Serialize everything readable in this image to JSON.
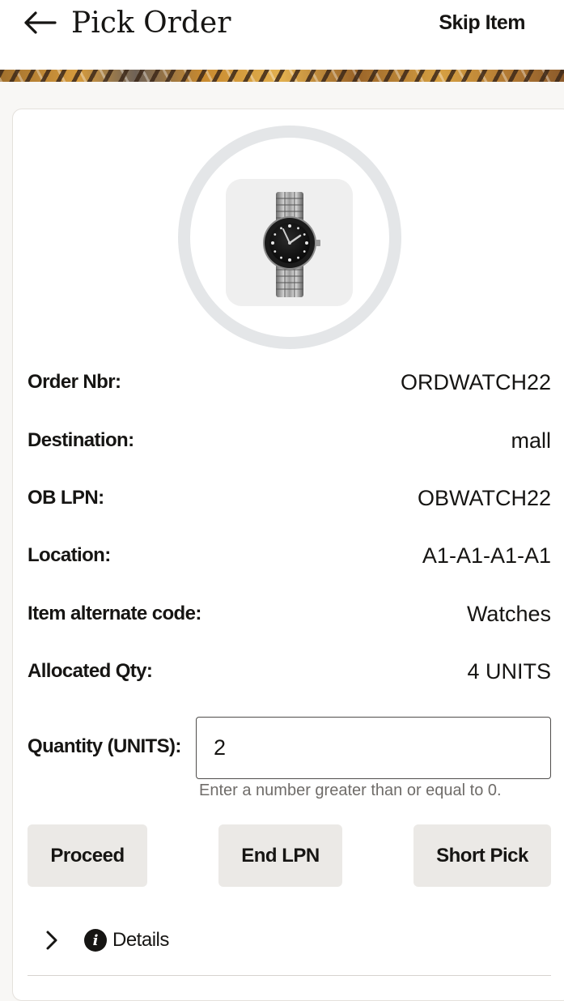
{
  "header": {
    "title": "Pick Order",
    "skip_label": "Skip Item",
    "back_icon": "arrow-left-icon"
  },
  "product": {
    "image_icon": "wristwatch-image"
  },
  "details_rows": [
    {
      "label": "Order Nbr:",
      "value": "ORDWATCH22"
    },
    {
      "label": "Destination:",
      "value": "mall"
    },
    {
      "label": "OB LPN:",
      "value": "OBWATCH22"
    },
    {
      "label": "Location:",
      "value": "A1-A1-A1-A1"
    },
    {
      "label": "Item alternate code:",
      "value": "Watches"
    },
    {
      "label": "Allocated Qty:",
      "value": "4 UNITS"
    }
  ],
  "quantity": {
    "label": "Quantity (UNITS):",
    "value": "2",
    "hint": "Enter a number greater than or equal to 0."
  },
  "actions": {
    "proceed_label": "Proceed",
    "end_lpn_label": "End LPN",
    "short_pick_label": "Short Pick"
  },
  "details_section": {
    "label": "Details",
    "info_glyph": "i",
    "expand_icon": "chevron-right-icon",
    "info_icon": "info-circle-icon"
  },
  "colors": {
    "page_background": "#f8f7f5",
    "button_background": "#ebe9e6",
    "ring": "#e4e6e8",
    "text": "#161513"
  }
}
